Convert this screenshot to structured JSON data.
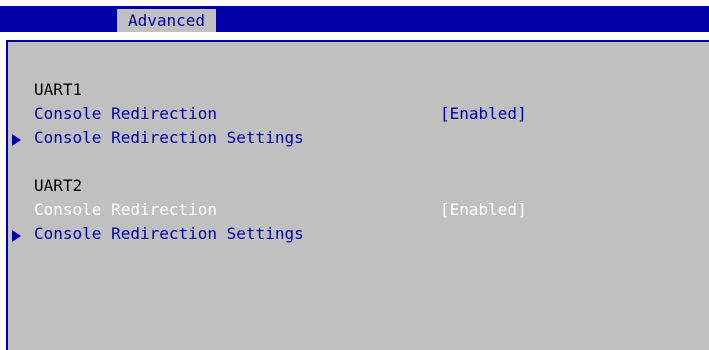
{
  "header": {
    "tabs": [
      {
        "label": "Advanced",
        "active": true
      }
    ]
  },
  "uart1": {
    "section_label": "UART1",
    "console_redirection": {
      "label": "Console Redirection",
      "value": "[Enabled]"
    },
    "settings_label": "Console Redirection Settings"
  },
  "uart2": {
    "section_label": "UART2",
    "console_redirection": {
      "label": "Console Redirection",
      "value": "[Enabled]",
      "selected": true
    },
    "settings_label": "Console Redirection Settings"
  },
  "colors": {
    "background": "#c0c0c0",
    "accent": "#0000a8",
    "selected_text": "#ffffff",
    "heading_text": "#000000"
  },
  "icons": {
    "submenu": "submenu-arrow-icon"
  }
}
